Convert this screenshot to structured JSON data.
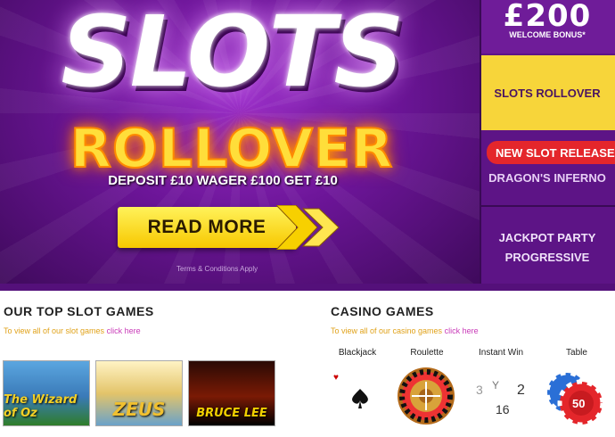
{
  "hero": {
    "title": "SLOTS",
    "subtitle": "ROLLOVER",
    "offer": "DEPOSIT £10 WAGER £100 GET £10",
    "cta_label": "READ MORE",
    "terms": "Terms & Conditions Apply"
  },
  "sidebar": {
    "bonus_amount": "£200",
    "bonus_label": "WELCOME BONUS*",
    "items": [
      {
        "label": "SLOTS ROLLOVER"
      },
      {
        "label": "NEW SLOT RELEASE"
      },
      {
        "label": "DRAGON'S INFERNO"
      },
      {
        "label": "JACKPOT PARTY"
      },
      {
        "label": "PROGRESSIVE"
      }
    ]
  },
  "slots": {
    "title": "OUR TOP SLOT GAMES",
    "link_prefix": "To view all of our slot games",
    "link_text": "click here",
    "games": [
      {
        "label": "The Wizard of Oz"
      },
      {
        "label": "ZEUS"
      },
      {
        "label": "BRUCE LEE"
      }
    ]
  },
  "casino": {
    "title": "CASINO GAMES",
    "link_prefix": "To view all of our casino games",
    "link_text": "click here",
    "games": [
      {
        "label": "Blackjack"
      },
      {
        "label": "Roulette"
      },
      {
        "label": "Instant Win"
      },
      {
        "label": "Table"
      }
    ]
  },
  "colors": {
    "hero_purple": "#6c1598",
    "accent_yellow": "#f7d53a",
    "badge_red": "#e4262b",
    "link_orange": "#e0a21a",
    "link_magenta": "#c83ab8"
  }
}
